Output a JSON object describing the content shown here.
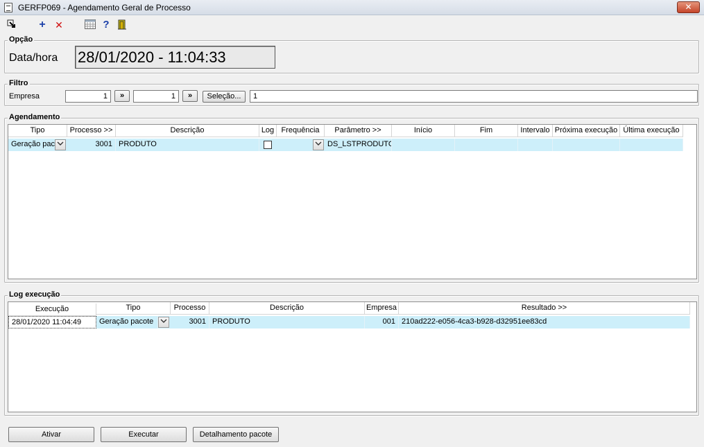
{
  "window": {
    "title": "GERFP069 - Agendamento Geral de Processo",
    "close_label": "✕"
  },
  "toolbar": {
    "add_label": "+",
    "delete_label": "✕",
    "help_label": "?"
  },
  "opcao": {
    "group_label": "Opção",
    "datetime_label": "Data/hora",
    "datetime_value": "28/01/2020  -  11:04:33"
  },
  "filtro": {
    "group_label": "Filtro",
    "empresa_label": "Empresa",
    "empresa_from": "1",
    "empresa_to": "1",
    "lookup_label": "»",
    "selecao_label": "Seleção...",
    "selecao_value": "1"
  },
  "agendamento": {
    "group_label": "Agendamento",
    "columns": [
      "Tipo",
      "Processo >>",
      "Descrição",
      "Log",
      "Frequência",
      "Parâmetro >>",
      "Início",
      "Fim",
      "Intervalo",
      "Próxima execução",
      "Última execução"
    ],
    "row": {
      "tipo": "Geração pac",
      "processo": "3001",
      "descricao": "PRODUTO",
      "log_checked": false,
      "frequencia": "",
      "parametro": "DS_LSTPRODUTO=",
      "inicio": "",
      "fim": "",
      "intervalo": "",
      "proxima": "",
      "ultima": ""
    }
  },
  "log": {
    "group_label": "Log execução",
    "columns": [
      "Execução",
      "Tipo",
      "Processo",
      "Descrição",
      "Empresa",
      "Resultado >>"
    ],
    "row": {
      "execucao": "28/01/2020 11:04:49",
      "tipo": "Geração pacote",
      "processo": "3001",
      "descricao": "PRODUTO",
      "empresa": "001",
      "resultado": "210ad222-e056-4ca3-b928-d32951ee83cd"
    }
  },
  "footer": {
    "ativar_label": "Ativar",
    "executar_label": "Executar",
    "detalhamento_label": "Detalhamento pacote"
  }
}
